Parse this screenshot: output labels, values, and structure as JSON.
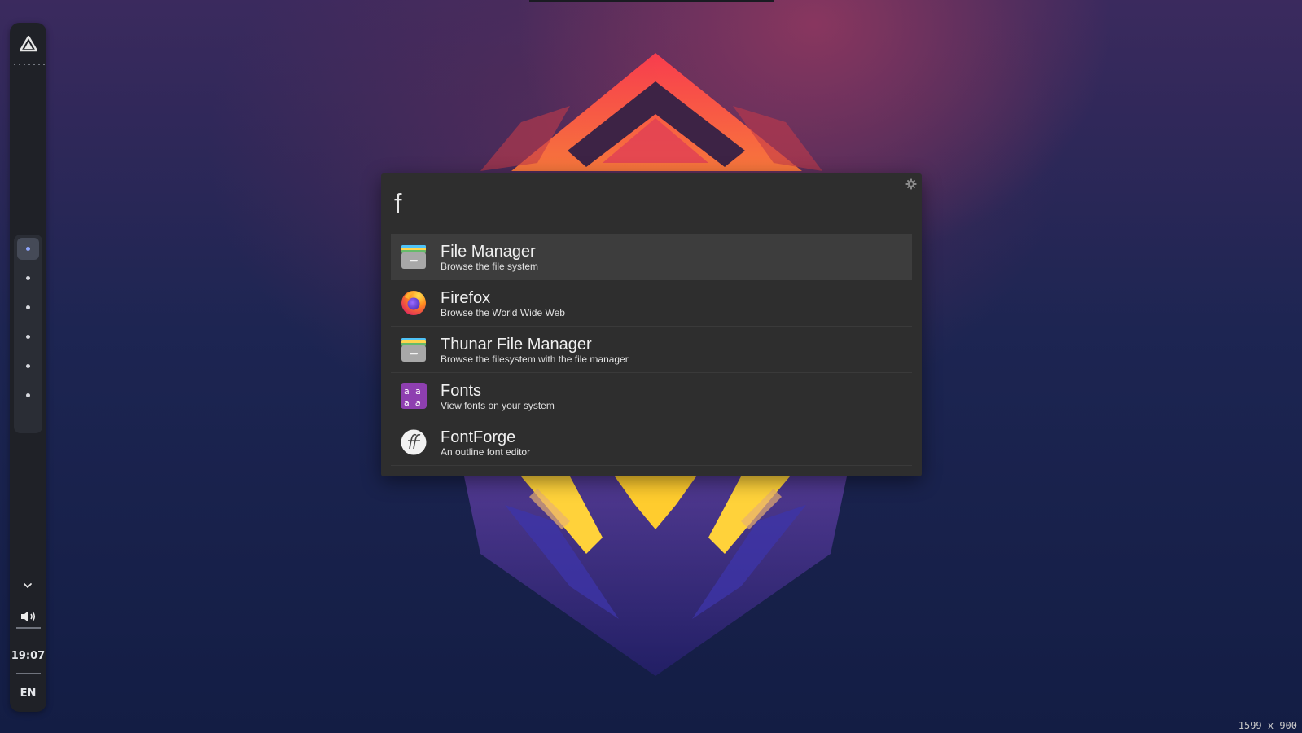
{
  "colors": {
    "panel_bg": "#1f2127",
    "launcher_bg": "#2e2e2e",
    "selected_row_bg": "#3d3d3d",
    "active_workspace_dot": "#8fa7ff"
  },
  "panel": {
    "logo_icon": "app-logo-icon",
    "workspaces": [
      {
        "index": 1,
        "active": true
      },
      {
        "index": 2,
        "active": false
      },
      {
        "index": 3,
        "active": false
      },
      {
        "index": 4,
        "active": false
      },
      {
        "index": 5,
        "active": false
      },
      {
        "index": 6,
        "active": false
      }
    ],
    "tray_expand_icon": "chevron-down-icon",
    "volume_icon": "volume-icon",
    "clock": "19:07",
    "language": "EN"
  },
  "launcher": {
    "query": "f",
    "settings_icon": "gear-icon",
    "results": [
      {
        "name": "File Manager",
        "description": "Browse the file system",
        "icon": "file-manager-icon",
        "selected": true
      },
      {
        "name": "Firefox",
        "description": "Browse the World Wide Web",
        "icon": "firefox-icon",
        "selected": false
      },
      {
        "name": "Thunar File Manager",
        "description": "Browse the filesystem with the file manager",
        "icon": "thunar-icon",
        "selected": false
      },
      {
        "name": "Fonts",
        "description": "View fonts on your system",
        "icon": "fonts-icon",
        "selected": false
      },
      {
        "name": "FontForge",
        "description": "An outline font editor",
        "icon": "fontforge-icon",
        "selected": false
      }
    ]
  },
  "screen": {
    "resolution_label": "1599 x 900"
  }
}
